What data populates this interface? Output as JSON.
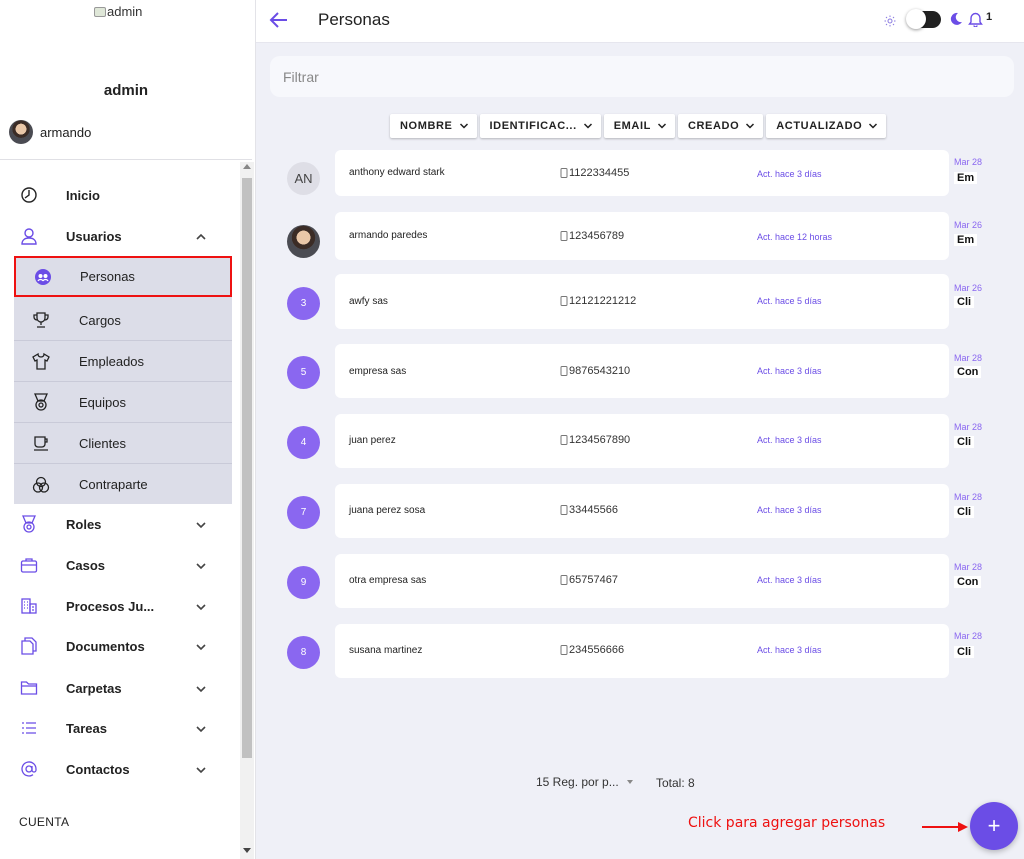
{
  "sidebar": {
    "logo_alt": "admin",
    "admin_name": "admin",
    "user_name": "armando",
    "menu": [
      {
        "label": "Inicio",
        "icon": "clock-icon"
      },
      {
        "label": "Usuarios",
        "icon": "user-icon"
      },
      {
        "label": "Roles",
        "icon": "badge-icon"
      },
      {
        "label": "Casos",
        "icon": "briefcase-icon"
      },
      {
        "label": "Procesos Ju...",
        "icon": "building-icon"
      },
      {
        "label": "Documentos",
        "icon": "documents-icon"
      },
      {
        "label": "Carpetas",
        "icon": "folder-icon"
      },
      {
        "label": "Tareas",
        "icon": "list-icon"
      },
      {
        "label": "Contactos",
        "icon": "at-icon"
      }
    ],
    "submenu": [
      {
        "label": "Personas",
        "icon": "people-icon"
      },
      {
        "label": "Cargos",
        "icon": "trophy-icon"
      },
      {
        "label": "Empleados",
        "icon": "shirt-icon"
      },
      {
        "label": "Equipos",
        "icon": "medal-icon"
      },
      {
        "label": "Clientes",
        "icon": "cup-icon"
      },
      {
        "label": "Contraparte",
        "icon": "circles-icon"
      }
    ],
    "section_label": "CUENTA"
  },
  "header": {
    "title": "Personas",
    "notification_count": "1"
  },
  "filter": {
    "placeholder": "Filtrar"
  },
  "sort_buttons": [
    "NOMBRE",
    "IDENTIFICAC...",
    "EMAIL",
    "CREADO",
    "ACTUALIZADO"
  ],
  "rows": [
    {
      "avatar": "AN",
      "name": "anthony edward stark",
      "phone": "1122334455",
      "status": "Act. hace 3 días",
      "date": "Mar 28",
      "badge": "Em"
    },
    {
      "avatar": "",
      "name": "armando paredes",
      "phone": "123456789",
      "status": "Act. hace 12 horas",
      "date": "Mar 26",
      "badge": "Em"
    },
    {
      "avatar": "3",
      "name": "awfy sas",
      "phone": "12121221212",
      "status": "Act. hace 5 días",
      "date": "Mar 26",
      "badge": "Cli"
    },
    {
      "avatar": "5",
      "name": "empresa sas",
      "phone": "9876543210",
      "status": "Act. hace 3 días",
      "date": "Mar 28",
      "badge": "Con"
    },
    {
      "avatar": "4",
      "name": "juan perez",
      "phone": "1234567890",
      "status": "Act. hace 3 días",
      "date": "Mar 28",
      "badge": "Cli"
    },
    {
      "avatar": "7",
      "name": "juana perez sosa",
      "phone": "33445566",
      "status": "Act. hace 3 días",
      "date": "Mar 28",
      "badge": "Cli"
    },
    {
      "avatar": "9",
      "name": "otra empresa sas",
      "phone": "65757467",
      "status": "Act. hace 3 días",
      "date": "Mar 28",
      "badge": "Con"
    },
    {
      "avatar": "8",
      "name": "susana martinez",
      "phone": "234556666",
      "status": "Act. hace 3 días",
      "date": "Mar 28",
      "badge": "Cli"
    }
  ],
  "pagination": {
    "per_page_label": "15 Reg. por p...",
    "total_label": "Total: 8"
  },
  "annotation": {
    "text": "Click para agregar personas"
  },
  "fab": {
    "label": "+"
  },
  "colors": {
    "accent": "#6b4de6",
    "annotation": "#e11111",
    "avatar_num": "#8a67f0"
  }
}
